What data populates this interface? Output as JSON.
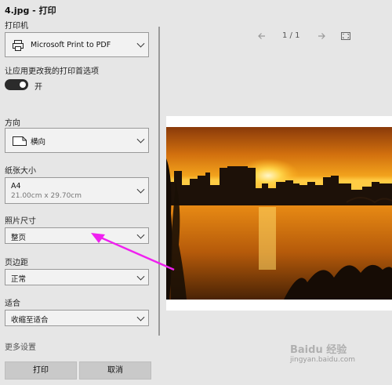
{
  "window": {
    "title": "4.jpg - 打印"
  },
  "printer": {
    "label": "打印机",
    "value": "Microsoft Print to PDF"
  },
  "app_prefs": {
    "label": "让应用更改我的打印首选项",
    "toggle_state": "开"
  },
  "orientation": {
    "label": "方向",
    "value": "横向"
  },
  "paper_size": {
    "label": "纸张大小",
    "value": "A4",
    "sub": "21.00cm x 29.70cm"
  },
  "photo_size": {
    "label": "照片尺寸",
    "value": "整页"
  },
  "margins": {
    "label": "页边距",
    "value": "正常"
  },
  "fit": {
    "label": "适合",
    "value": "收缩至适合"
  },
  "more_settings": {
    "label": "更多设置"
  },
  "buttons": {
    "print": "打印",
    "cancel": "取消"
  },
  "nav": {
    "page": "1 / 1"
  },
  "watermark": {
    "line1": "Baidu 经验",
    "line2": "jingyan.baidu.com"
  },
  "colors": {
    "arrow": "#f020f0",
    "panel_bg": "#e6e6e6",
    "toggle_on": "#2b2b2b"
  }
}
